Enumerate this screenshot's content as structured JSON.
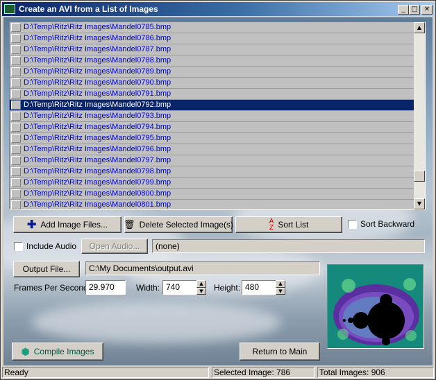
{
  "window": {
    "title": "Create an AVI from a List of Images",
    "controls": {
      "minimize": "_",
      "maximize": "□",
      "close": "✕"
    }
  },
  "file_list": {
    "items": [
      "D:\\Temp\\Ritz\\Ritz Images\\Mandel0785.bmp",
      "D:\\Temp\\Ritz\\Ritz Images\\Mandel0786.bmp",
      "D:\\Temp\\Ritz\\Ritz Images\\Mandel0787.bmp",
      "D:\\Temp\\Ritz\\Ritz Images\\Mandel0788.bmp",
      "D:\\Temp\\Ritz\\Ritz Images\\Mandel0789.bmp",
      "D:\\Temp\\Ritz\\Ritz Images\\Mandel0790.bmp",
      "D:\\Temp\\Ritz\\Ritz Images\\Mandel0791.bmp",
      "D:\\Temp\\Ritz\\Ritz Images\\Mandel0792.bmp",
      "D:\\Temp\\Ritz\\Ritz Images\\Mandel0793.bmp",
      "D:\\Temp\\Ritz\\Ritz Images\\Mandel0794.bmp",
      "D:\\Temp\\Ritz\\Ritz Images\\Mandel0795.bmp",
      "D:\\Temp\\Ritz\\Ritz Images\\Mandel0796.bmp",
      "D:\\Temp\\Ritz\\Ritz Images\\Mandel0797.bmp",
      "D:\\Temp\\Ritz\\Ritz Images\\Mandel0798.bmp",
      "D:\\Temp\\Ritz\\Ritz Images\\Mandel0799.bmp",
      "D:\\Temp\\Ritz\\Ritz Images\\Mandel0800.bmp",
      "D:\\Temp\\Ritz\\Ritz Images\\Mandel0801.bmp"
    ],
    "selected_index": 7
  },
  "buttons": {
    "add_files": "Add Image Files...",
    "delete_selected": "Delete Selected Image(s)",
    "sort_list": "Sort List",
    "open_audio": "Open Audio...",
    "output_file": "Output File...",
    "compile": "Compile Images",
    "return_main": "Return to Main"
  },
  "options": {
    "sort_backward_label": "Sort Backward",
    "sort_backward_checked": false,
    "include_audio_label": "Include Audio",
    "include_audio_checked": false,
    "audio_file": "(none)"
  },
  "output": {
    "path": "C:\\My Documents\\output.avi",
    "fps_label": "Frames Per Second:",
    "fps": "29.970",
    "width_label": "Width:",
    "width": "740",
    "height_label": "Height:",
    "height": "480"
  },
  "status_bar": {
    "state": "Ready",
    "selected": "Selected Image: 786",
    "total": "Total Images: 906"
  },
  "colors": {
    "title_gradient_start": "#0a246a",
    "selection": "#0a246a",
    "path_text": "#0000d0"
  }
}
